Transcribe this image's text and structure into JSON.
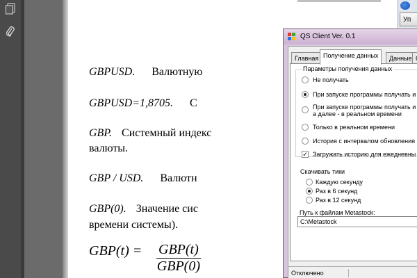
{
  "viewer": {
    "icons": [
      "pages-icon",
      "paperclip-icon"
    ]
  },
  "document": {
    "line1": {
      "term": "GBPUSD.",
      "text": "Валютную"
    },
    "line2": {
      "term": "GBPUSD=1,8705.",
      "text": "С"
    },
    "line3": {
      "term": "GBP.",
      "text": "Системный индекс"
    },
    "line3b": "валюты.",
    "line4": {
      "term": "GBP / USD.",
      "text": "Валютн"
    },
    "line5": {
      "term": "GBP(0).",
      "text": "Значение сис"
    },
    "line5b": "времени системы).",
    "formula": {
      "lhs": "GBP(t) =",
      "num": "GBP(t)",
      "den": "GBP(0)"
    }
  },
  "background_window": {
    "button_label": "Уп"
  },
  "qs_client": {
    "title": "QS Client Ver. 0.1",
    "tabs": [
      "Главная",
      "Получение данных",
      "Данные",
      "С"
    ],
    "active_tab": 1,
    "data_params": {
      "label": "Параметры получения данных",
      "options": [
        {
          "label": "Не получать",
          "selected": false
        },
        {
          "label": "При запуске программы получать и",
          "selected": true
        },
        {
          "label": "При запуске программы получать и",
          "label2": "а далее - в реальном времени",
          "selected": false
        },
        {
          "label": "Только в реальном времени",
          "selected": false
        },
        {
          "label": "История с интервалом обновления",
          "selected": false
        }
      ],
      "checkbox": {
        "label": "Загружать историю для ежедневны",
        "checked": true
      }
    },
    "ticks": {
      "label": "Скачивать тики",
      "options": [
        {
          "label": "Каждую секунду",
          "selected": false
        },
        {
          "label": "Раз в 6 секунд",
          "selected": true
        },
        {
          "label": "Раз в 12 секунд",
          "selected": false
        }
      ]
    },
    "path": {
      "label": "Путь к файлам Metastock:",
      "value": "C:\\Metastock"
    },
    "status": "Отключено"
  }
}
